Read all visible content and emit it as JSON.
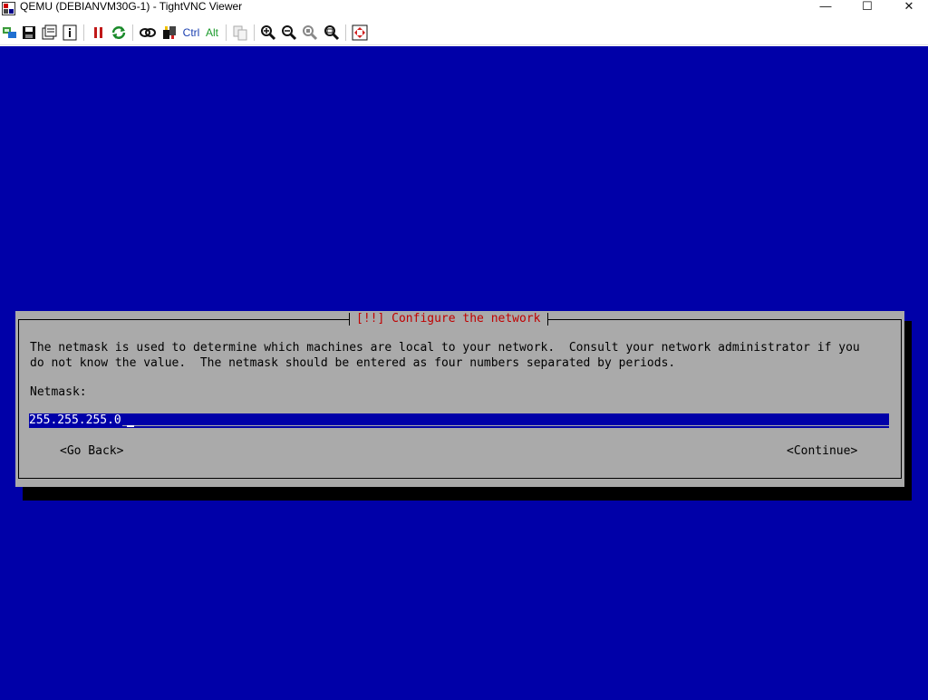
{
  "window": {
    "title": "QEMU (DEBIANVM30G-1) - TightVNC Viewer",
    "controls": {
      "minimize": "—",
      "maximize": "☐",
      "close": "✕"
    }
  },
  "toolbar": {
    "ctrl_label": "Ctrl",
    "alt_label": "Alt",
    "icons": [
      "new-connection-icon",
      "save-icon",
      "options-icon",
      "info-icon",
      "pause-icon",
      "refresh-icon",
      "transfer-icon",
      "ctrl-alt-del-icon",
      "copy-icon",
      "zoom-in-icon",
      "zoom-out-icon",
      "zoom-100-icon",
      "zoom-fit-icon",
      "fullscreen-icon"
    ]
  },
  "colors": {
    "screen_bg": "#0000a8",
    "dialog_bg": "#aaaaaa",
    "title_red": "#c00000"
  },
  "dialog": {
    "title": "[!!] Configure the network",
    "description_line1": "The netmask is used to determine which machines are local to your network.  Consult your network administrator if you",
    "description_line2": "do not know the value.  The netmask should be entered as four numbers separated by periods.",
    "field_label": "Netmask:",
    "netmask_value": "255.255.255.0",
    "go_back": "<Go Back>",
    "continue": "<Continue>"
  }
}
